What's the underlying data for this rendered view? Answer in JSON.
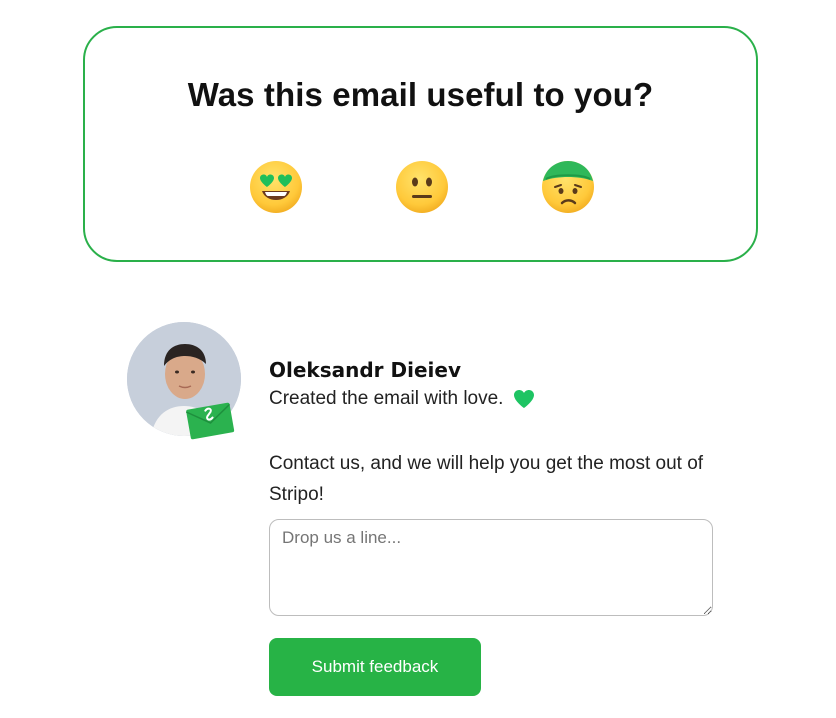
{
  "survey": {
    "title": "Was this email useful to you?",
    "options": [
      {
        "icon": "heart-eyes-emoji-icon",
        "meaning": "useful"
      },
      {
        "icon": "neutral-face-emoji-icon",
        "meaning": "neutral"
      },
      {
        "icon": "bandaged-face-emoji-icon",
        "meaning": "not useful"
      }
    ],
    "border_color": "#2ab04a"
  },
  "signature": {
    "name": "Oleksandr Dieiev",
    "tagline": "Created the email with love.",
    "heart_icon": "green-heart-icon",
    "contact_text": "Contact us, and we will help you get the most out of Stripo!"
  },
  "form": {
    "placeholder": "Drop us a line...",
    "value": "",
    "submit_label": "Submit feedback"
  },
  "colors": {
    "accent": "#27b346",
    "text": "#222222"
  }
}
